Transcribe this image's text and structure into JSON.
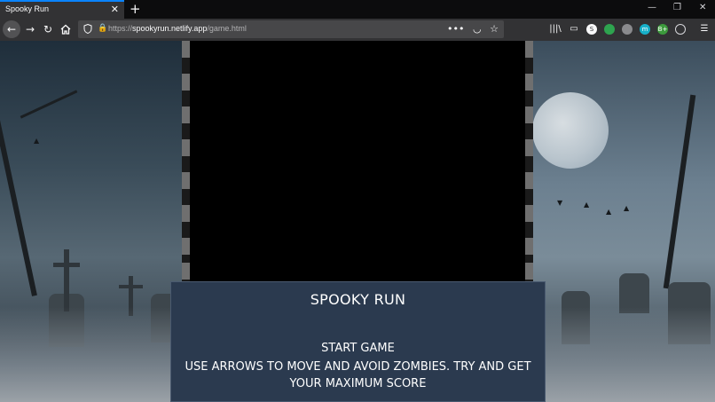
{
  "browser": {
    "tab_title": "Spooky Run",
    "tab_close": "✕",
    "new_tab": "+",
    "window_controls": [
      "—",
      "❐",
      "✕"
    ],
    "url_scheme": "https://",
    "url_host": "spookyrun.netlify.app",
    "url_path": "/game.html",
    "page_actions": "•••",
    "extension_labels": [
      "S",
      "",
      "",
      "m",
      "B+",
      ""
    ],
    "colors": {
      "accent": "#0a84ff",
      "toolbar": "#323234",
      "urlbar": "#474749"
    }
  },
  "game": {
    "title": "SPOOKY RUN",
    "start_label": "START GAME",
    "instructions": "USE ARROWS TO MOVE AND AVOID ZOMBIES. TRY AND GET YOUR MAXIMUM SCORE",
    "panel_color": "#2b3a4f",
    "canvas_color": "#000000"
  }
}
